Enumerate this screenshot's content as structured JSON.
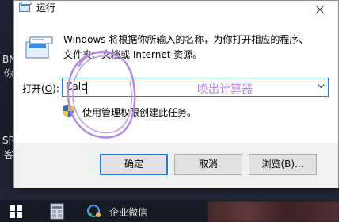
{
  "desktop": {
    "labels": [
      {
        "text": "BN"
      },
      {
        "text": "你"
      },
      {
        "text": "SR"
      },
      {
        "text": "客"
      }
    ]
  },
  "dialog": {
    "title": "运行",
    "description_line1": "Windows 将根据你所输入的名称，为你打开相应的程序、",
    "description_line2": "文件夹、文档或 Internet 资源。",
    "open_label_text": "打开(",
    "open_label_key": "O",
    "open_label_end": "):",
    "input_value": "Calc",
    "annotation": "唤出计算器",
    "admin_note": "使用管理权限创建此任务。",
    "buttons": {
      "ok": "确定",
      "cancel": "取消",
      "browse": "浏览(B)..."
    }
  },
  "taskbar": {
    "app_label": "企业微信"
  },
  "colors": {
    "accent": "#2b79d7",
    "annotation": "#b58ae0"
  }
}
